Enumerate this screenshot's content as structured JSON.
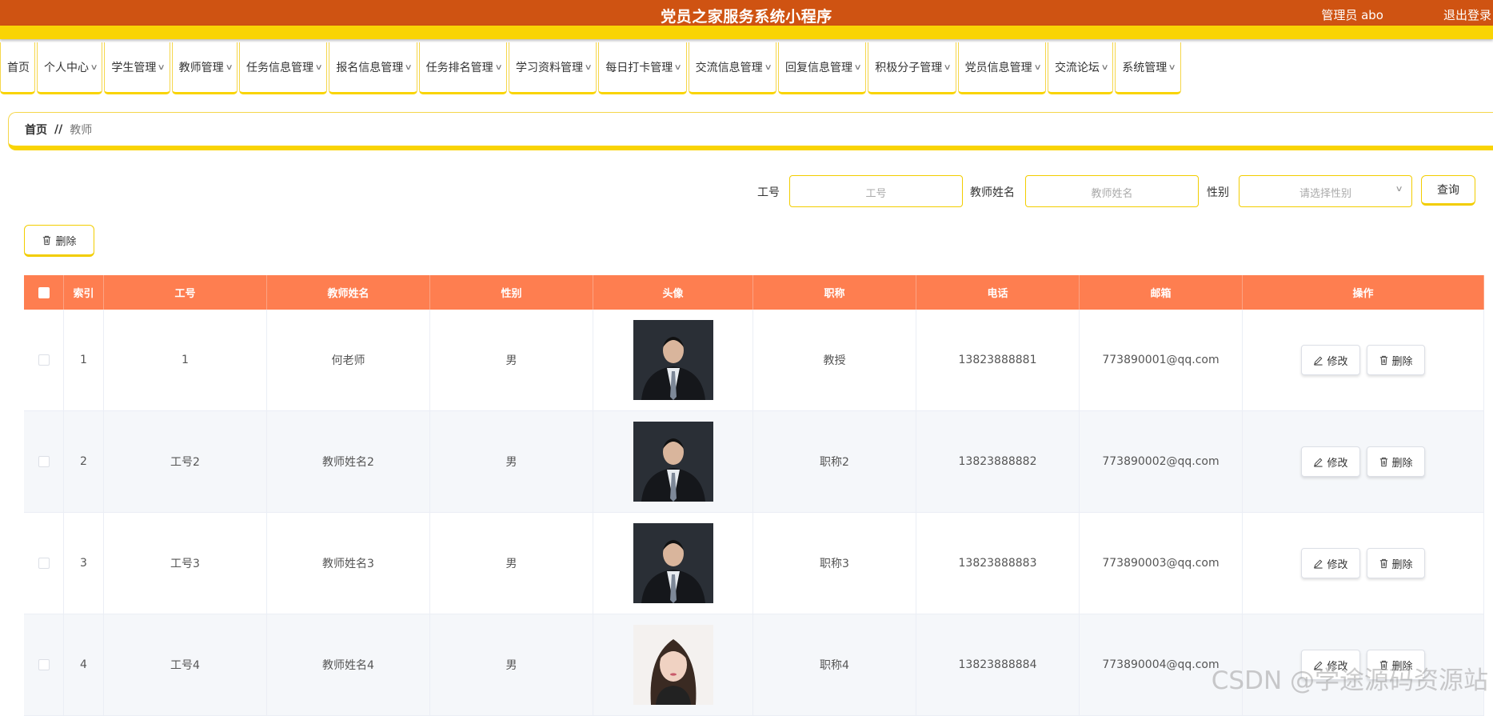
{
  "header": {
    "title": "党员之家服务系统小程序",
    "admin": "管理员 abo",
    "logout": "退出登录"
  },
  "nav": {
    "items": [
      {
        "label": "首页",
        "has_dropdown": false
      },
      {
        "label": "个人中心",
        "has_dropdown": true
      },
      {
        "label": "学生管理",
        "has_dropdown": true
      },
      {
        "label": "教师管理",
        "has_dropdown": true
      },
      {
        "label": "任务信息管理",
        "has_dropdown": true
      },
      {
        "label": "报名信息管理",
        "has_dropdown": true
      },
      {
        "label": "任务排名管理",
        "has_dropdown": true
      },
      {
        "label": "学习资料管理",
        "has_dropdown": true
      },
      {
        "label": "每日打卡管理",
        "has_dropdown": true
      },
      {
        "label": "交流信息管理",
        "has_dropdown": true
      },
      {
        "label": "回复信息管理",
        "has_dropdown": true
      },
      {
        "label": "积极分子管理",
        "has_dropdown": true
      },
      {
        "label": "党员信息管理",
        "has_dropdown": true
      },
      {
        "label": "交流论坛",
        "has_dropdown": true
      },
      {
        "label": "系统管理",
        "has_dropdown": true
      }
    ]
  },
  "breadcrumb": {
    "home": "首页",
    "separator": "//",
    "current": "教师"
  },
  "search": {
    "id_label": "工号",
    "id_placeholder": "工号",
    "name_label": "教师姓名",
    "name_placeholder": "教师姓名",
    "gender_label": "性别",
    "gender_placeholder": "请选择性别",
    "query_button": "查询"
  },
  "toolbar": {
    "delete_label": "删除"
  },
  "table": {
    "columns": [
      "索引",
      "工号",
      "教师姓名",
      "性别",
      "头像",
      "职称",
      "电话",
      "邮箱",
      "操作"
    ],
    "rows": [
      {
        "index": "1",
        "id": "1",
        "name": "何老师",
        "gender": "男",
        "avatar": "man",
        "title": "教授",
        "phone": "13823888881",
        "email": "773890001@qq.com"
      },
      {
        "index": "2",
        "id": "工号2",
        "name": "教师姓名2",
        "gender": "男",
        "avatar": "man",
        "title": "职称2",
        "phone": "13823888882",
        "email": "773890002@qq.com"
      },
      {
        "index": "3",
        "id": "工号3",
        "name": "教师姓名3",
        "gender": "男",
        "avatar": "man",
        "title": "职称3",
        "phone": "13823888883",
        "email": "773890003@qq.com"
      },
      {
        "index": "4",
        "id": "工号4",
        "name": "教师姓名4",
        "gender": "男",
        "avatar": "woman",
        "title": "职称4",
        "phone": "13823888884",
        "email": "773890004@qq.com"
      }
    ],
    "edit_label": "修改",
    "delete_label": "删除"
  },
  "watermark": "CSDN @学途源码资源站",
  "colors": {
    "header_bg": "#cf5312",
    "accent_yellow": "#f9d404",
    "table_header": "#fe7e50"
  }
}
